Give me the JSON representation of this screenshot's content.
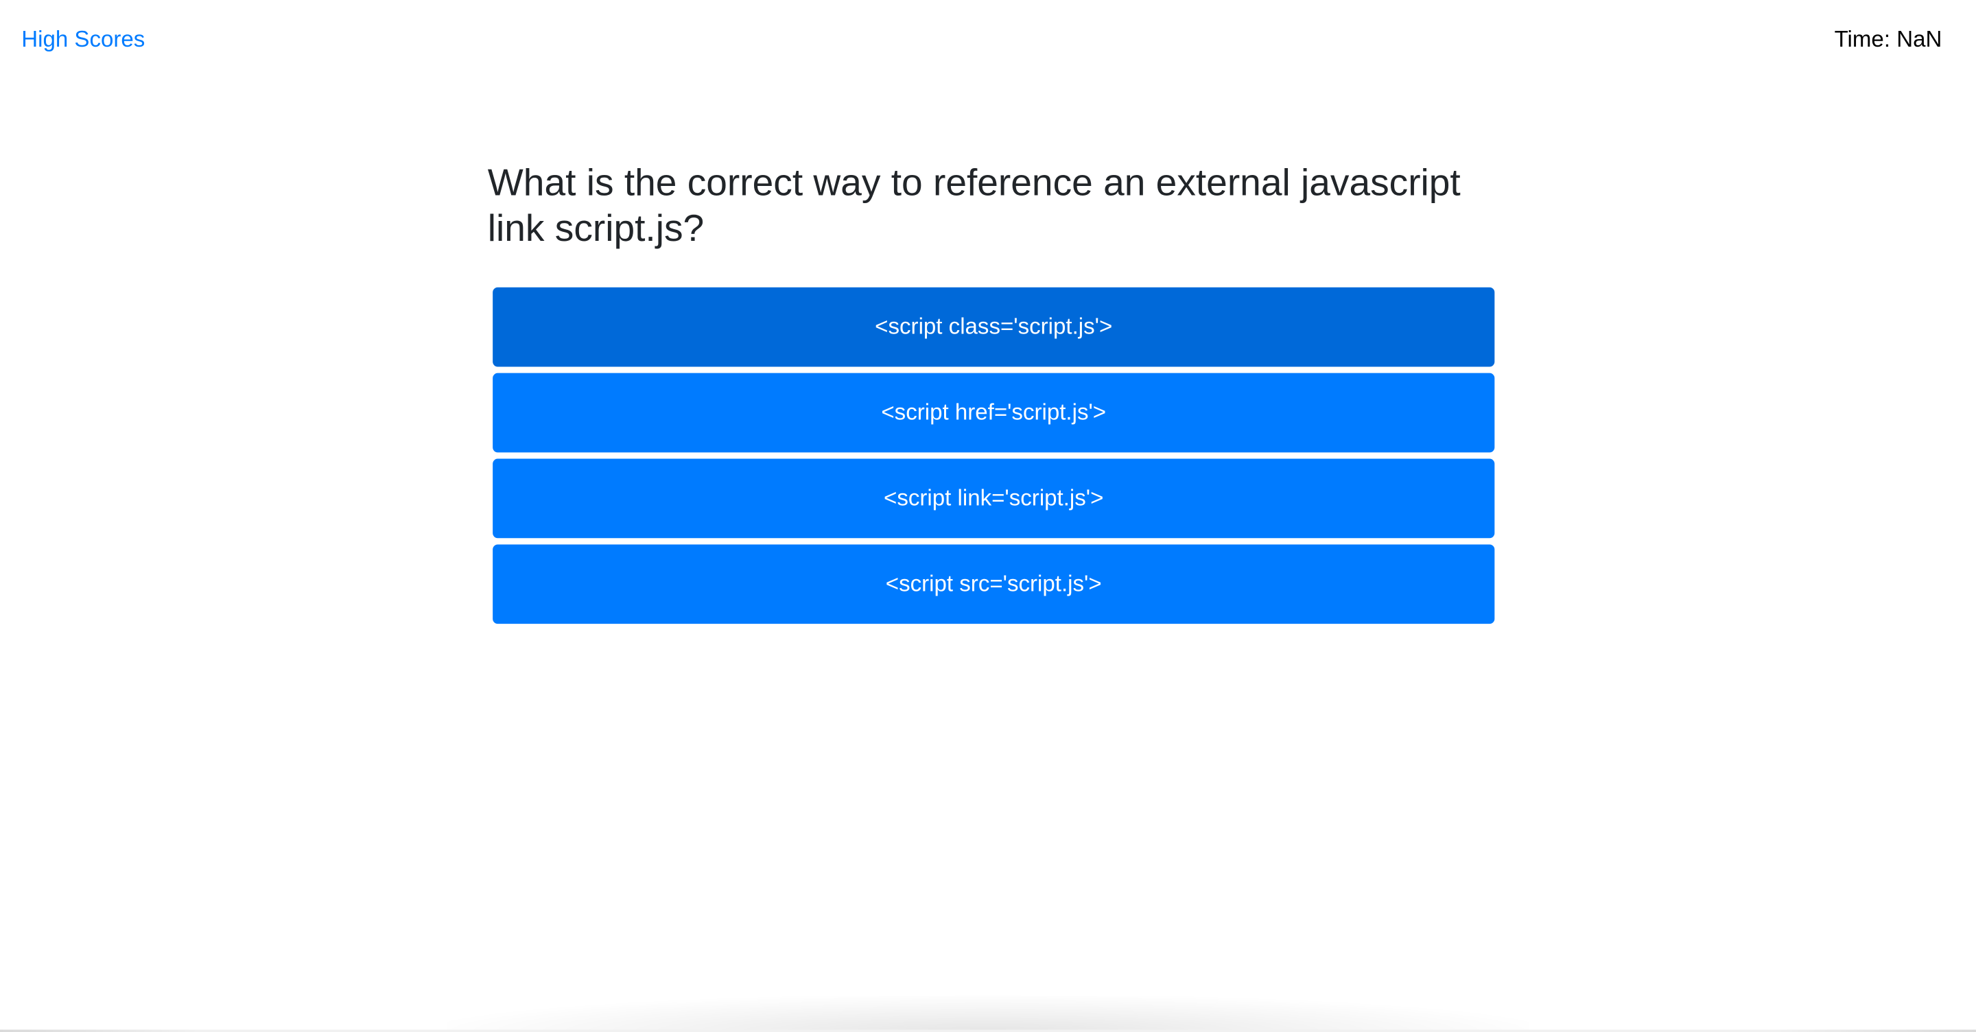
{
  "header": {
    "high_scores_label": "High Scores",
    "timer_label": "Time:",
    "timer_value": "NaN"
  },
  "quiz": {
    "question": "What is the correct way to reference an external javascript link script.js?",
    "answers": [
      {
        "label": "<script class='script.js'>"
      },
      {
        "label": "<script href='script.js'>"
      },
      {
        "label": "<script link='script.js'>"
      },
      {
        "label": "<script src='script.js'>"
      }
    ]
  },
  "colors": {
    "link": "#007bff",
    "button": "#007bff",
    "button_hover": "#0069d9",
    "button_text": "#ffffff",
    "heading_text": "#212529"
  }
}
